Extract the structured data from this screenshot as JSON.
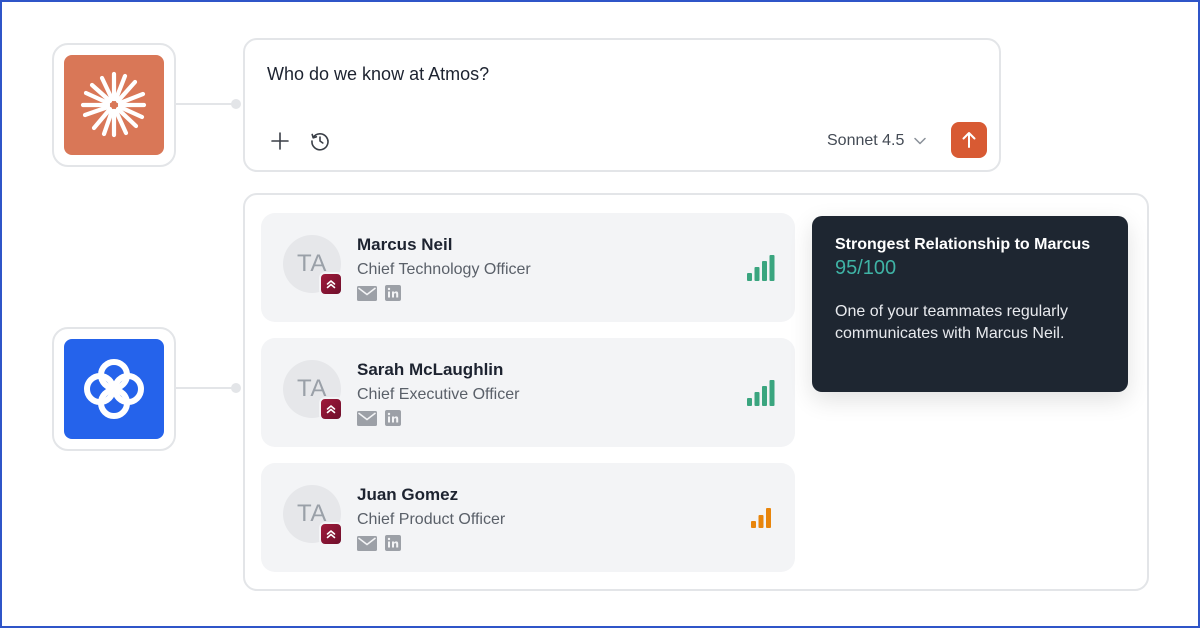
{
  "prompt": {
    "text": "Who do we know at Atmos?",
    "model": "Sonnet 4.5",
    "icons": [
      "plus-icon",
      "history-icon",
      "chevron-down-icon",
      "arrow-up-icon"
    ]
  },
  "apps": [
    {
      "name": "claude-logo",
      "color": "#d97757"
    },
    {
      "name": "app-logo",
      "color": "#2563eb"
    }
  ],
  "contacts": [
    {
      "initials": "TA",
      "name": "Marcus Neil",
      "title": "Chief Technology Officer",
      "strength": "strong",
      "signal_color": "#3aa57f"
    },
    {
      "initials": "TA",
      "name": "Sarah McLaughlin",
      "title": "Chief Executive Officer",
      "strength": "strong",
      "signal_color": "#3aa57f"
    },
    {
      "initials": "TA",
      "name": "Juan Gomez",
      "title": "Chief Product Officer",
      "strength": "medium",
      "signal_color": "#e8850c"
    }
  ],
  "tooltip": {
    "title": "Strongest Relationship to Marcus",
    "score": "95/100",
    "body": "One of your teammates regularly communicates with Marcus Neil."
  },
  "colors": {
    "accent": "#d85a33",
    "tooltip_bg": "#1e2631",
    "score": "#3fb3a5"
  }
}
